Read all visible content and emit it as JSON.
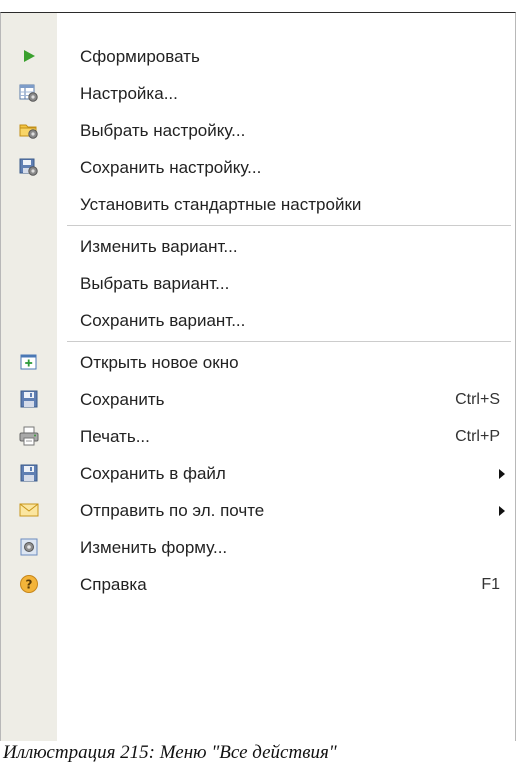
{
  "menu": {
    "groups": [
      [
        {
          "label": "Сформировать",
          "icon": "play-icon"
        },
        {
          "label": "Настройка...",
          "icon": "settings-table-icon"
        },
        {
          "label": "Выбрать настройку...",
          "icon": "folder-gear-icon"
        },
        {
          "label": "Сохранить настройку...",
          "icon": "save-gear-icon"
        },
        {
          "label": "Установить стандартные настройки",
          "icon": ""
        }
      ],
      [
        {
          "label": "Изменить вариант...",
          "icon": ""
        },
        {
          "label": "Выбрать вариант...",
          "icon": ""
        },
        {
          "label": "Сохранить вариант...",
          "icon": ""
        }
      ],
      [
        {
          "label": "Открыть новое окно",
          "icon": "new-window-icon"
        },
        {
          "label": "Сохранить",
          "icon": "floppy-disk-icon",
          "shortcut": "Ctrl+S"
        },
        {
          "label": "Печать...",
          "icon": "printer-icon",
          "shortcut": "Ctrl+P"
        },
        {
          "label": "Сохранить в файл",
          "icon": "floppy-disk-icon",
          "submenu": true
        },
        {
          "label": "Отправить по эл. почте",
          "icon": "envelope-icon",
          "submenu": true
        },
        {
          "label": "Изменить форму...",
          "icon": "form-gear-icon"
        },
        {
          "label": "Справка",
          "icon": "help-icon",
          "shortcut": "F1"
        }
      ]
    ]
  },
  "caption": "Иллюстрация 215: Меню \"Все действия\"",
  "colors": {
    "gutter": "#eeede6",
    "separator": "#cccccc",
    "play_green": "#3aa12e"
  }
}
